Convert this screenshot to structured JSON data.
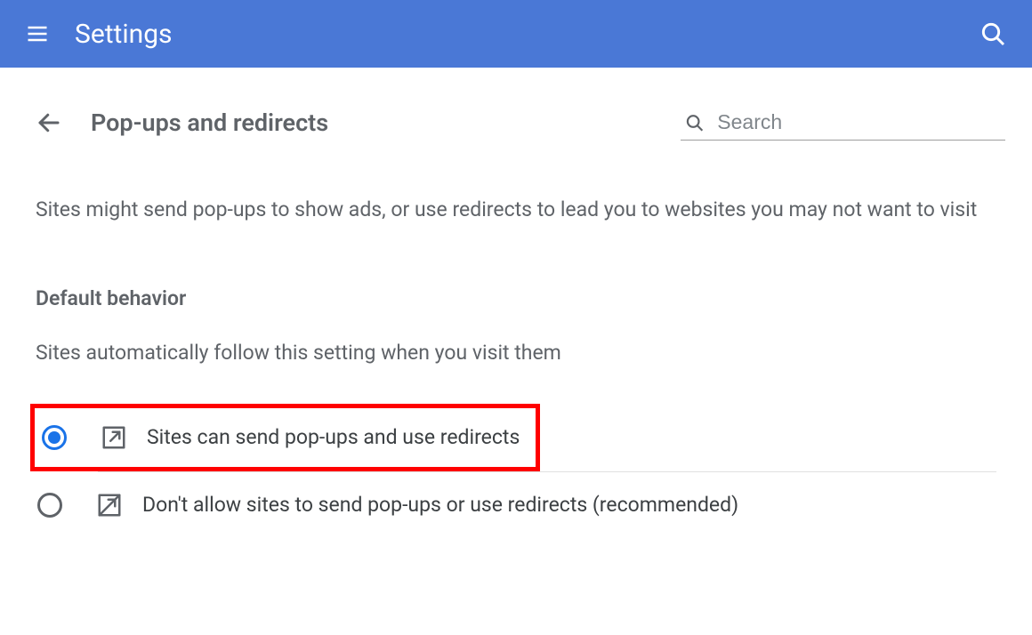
{
  "header": {
    "title": "Settings"
  },
  "page": {
    "title": "Pop-ups and redirects",
    "search_placeholder": "Search",
    "description": "Sites might send pop-ups to show ads, or use redirects to lead you to websites you may not want to visit",
    "section_label": "Default behavior",
    "section_sub": "Sites automatically follow this setting when you visit them"
  },
  "options": [
    {
      "label": "Sites can send pop-ups and use redirects",
      "selected": true,
      "highlighted": true
    },
    {
      "label": "Don't allow sites to send pop-ups or use redirects (recommended)",
      "selected": false,
      "highlighted": false
    }
  ]
}
